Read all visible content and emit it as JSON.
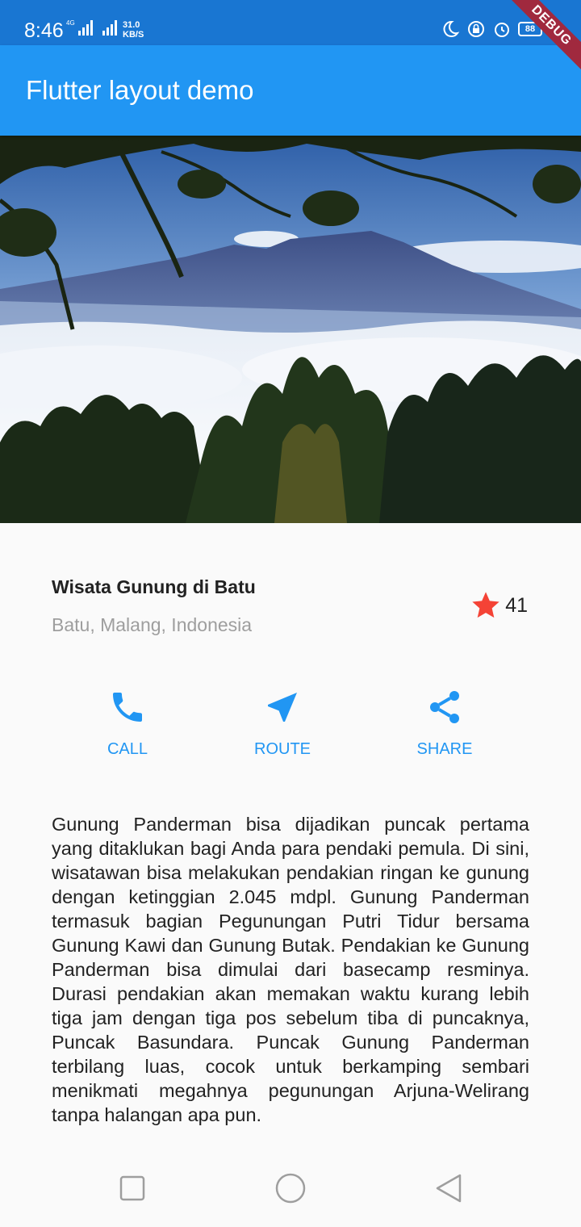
{
  "status_bar": {
    "time": "8:46",
    "network_type": "4G",
    "net_speed_value": "31.0",
    "net_speed_unit": "KB/S",
    "battery": "88",
    "icons": [
      "moon-icon",
      "vpn-lock-icon",
      "alarm-icon",
      "battery-icon",
      "charging-icon"
    ]
  },
  "debug_banner": "DEBUG",
  "app_bar": {
    "title": "Flutter layout demo",
    "color": "#2196f3"
  },
  "hero_image": {
    "description": "mountain-above-clouds-with-trees"
  },
  "title_section": {
    "title": "Wisata Gunung di Batu",
    "subtitle": "Batu, Malang, Indonesia",
    "rating_icon": "star-icon",
    "rating_color": "#f44336",
    "rating_count": "41"
  },
  "actions": [
    {
      "label": "CALL",
      "icon": "phone-icon"
    },
    {
      "label": "ROUTE",
      "icon": "navigation-icon"
    },
    {
      "label": "SHARE",
      "icon": "share-icon"
    }
  ],
  "accent_color": "#2196f3",
  "description": "Gunung Panderman bisa dijadikan puncak pertama yang ditaklukan bagi Anda para pendaki pemula. Di sini, wisatawan bisa melakukan pendakian ringan ke gunung dengan ketinggian 2.045 mdpl. Gunung Panderman termasuk bagian Pegunungan Putri Tidur bersama Gunung Kawi dan Gunung Butak. Pendakian ke Gunung Panderman bisa dimulai dari basecamp resminya. Durasi pendakian akan memakan waktu kurang lebih tiga jam dengan tiga pos sebelum tiba di puncaknya, Puncak Basundara. Puncak Gunung Panderman terbilang luas, cocok untuk berkamping sembari menikmati megahnya pegunungan Arjuna-Welirang tanpa halangan apa pun.",
  "nav_bar": {
    "buttons": [
      "recent-apps-icon",
      "home-icon",
      "back-icon"
    ]
  }
}
